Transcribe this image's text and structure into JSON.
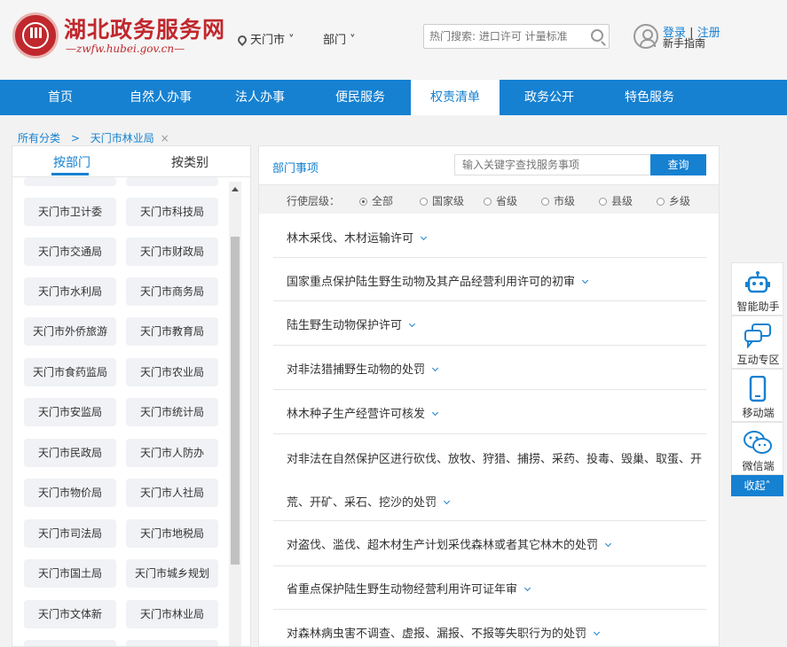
{
  "header": {
    "site_title": "湖北政务服务网",
    "site_url": "—zwfw.hubei.gov.cn—",
    "location": "天门市",
    "department": "部门",
    "search_placeholder": "热门搜索: 进口许可 计量标准",
    "login": "登录",
    "separator": "|",
    "register": "注册",
    "guide": "新手指南"
  },
  "nav": [
    "首页",
    "自然人办事",
    "法人办事",
    "便民服务",
    "权责清单",
    "政务公开",
    "特色服务"
  ],
  "breadcrumb": {
    "root": "所有分类",
    "arrow": ">",
    "current": "天门市林业局",
    "close": "×"
  },
  "left": {
    "tab_dept": "按部门",
    "tab_category": "按类别",
    "depts": [
      [
        "天门市卫计委",
        "天门市科技局"
      ],
      [
        "天门市交通局",
        "天门市财政局"
      ],
      [
        "天门市水利局",
        "天门市商务局"
      ],
      [
        "天门市外侨旅游",
        "天门市教育局"
      ],
      [
        "天门市食药监局",
        "天门市农业局"
      ],
      [
        "天门市安监局",
        "天门市统计局"
      ],
      [
        "天门市民政局",
        "天门市人防办"
      ],
      [
        "天门市物价局",
        "天门市人社局"
      ],
      [
        "天门市司法局",
        "天门市地税局"
      ],
      [
        "天门市国土局",
        "天门市城乡规划"
      ],
      [
        "天门市文体新",
        "天门市林业局"
      ]
    ]
  },
  "right": {
    "title": "部门事项",
    "search_placeholder": "输入关键字查找服务事项",
    "search_button": "查询",
    "level_label": "行使层级：",
    "levels": [
      "全部",
      "国家级",
      "省级",
      "市级",
      "县级",
      "乡级"
    ],
    "selected_level": "全部",
    "items": [
      "林木采伐、木材运输许可",
      "国家重点保护陆生野生动物及其产品经营利用许可的初审",
      "陆生野生动物保护许可",
      "对非法猎捕野生动物的处罚",
      "林木种子生产经营许可核发",
      "对非法在自然保护区进行砍伐、放牧、狩猎、捕捞、采药、投毒、毁巢、取蛋、开",
      "荒、开矿、采石、挖沙的处罚",
      "对盗伐、滥伐、超木材生产计划采伐森林或者其它林木的处罚",
      "省重点保护陆生野生动物经营利用许可证年审",
      "对森林病虫害不调查、虚报、漏报、不报等失职行为的处罚"
    ]
  },
  "sidebar_tools": {
    "assistant": "智能助手",
    "interaction": "互动专区",
    "mobile": "移动端",
    "wechat": "微信端",
    "collapse": "收起",
    "collapse_arrow": "˄"
  },
  "colors": {
    "brand_red": "#c0282d",
    "primary_blue": "#1681d1"
  }
}
